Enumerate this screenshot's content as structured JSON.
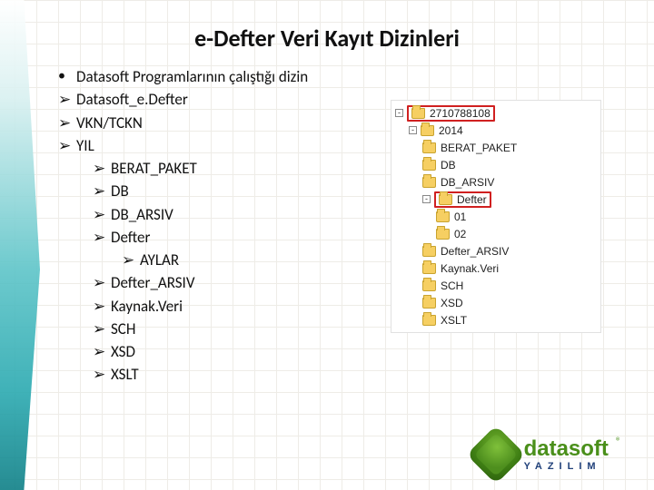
{
  "title": "e-Defter Veri Kayıt Dizinleri",
  "bullets": {
    "lv0": "Datasoft Programlarının çalıştığı dizin",
    "lv1": [
      "Datasoft_e.Defter",
      "VKN/TCKN",
      "YIL"
    ],
    "lv2a": [
      "BERAT_PAKET",
      "DB",
      "DB_ARSIV",
      "Defter"
    ],
    "lv3": "AYLAR",
    "lv2b": [
      "Defter_ARSIV",
      "Kaynak.Veri",
      "SCH",
      "XSD",
      "XSLT"
    ]
  },
  "tree": {
    "root": "2710788108",
    "year": "2014",
    "items": [
      "BERAT_PAKET",
      "DB",
      "DB_ARSIV",
      "Defter",
      "01",
      "02",
      "Defter_ARSIV",
      "Kaynak.Veri",
      "SCH",
      "XSD",
      "XSLT"
    ],
    "highlight": "Defter",
    "months_indent": [
      "01",
      "02"
    ]
  },
  "logo": {
    "main": "datasoft",
    "sub": "YAZILIM",
    "r": "®"
  },
  "marks": {
    "dot": "•",
    "arrow": "➢"
  }
}
